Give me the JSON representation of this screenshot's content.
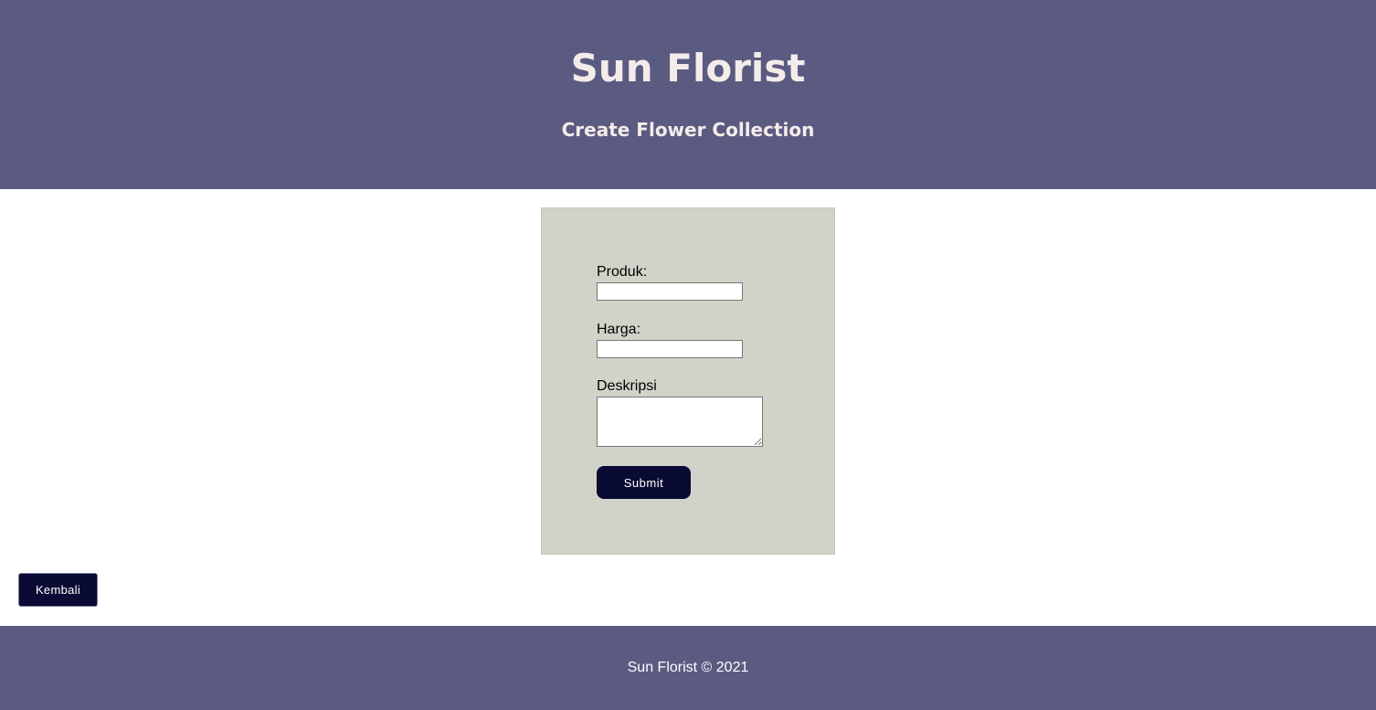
{
  "header": {
    "title": "Sun Florist",
    "subtitle": "Create Flower Collection"
  },
  "form": {
    "produk_label": "Produk:",
    "produk_value": "",
    "harga_label": "Harga:",
    "harga_value": "",
    "deskripsi_label": "Deskripsi",
    "deskripsi_value": "",
    "submit_label": "Submit"
  },
  "navigation": {
    "back_label": "Kembali"
  },
  "footer": {
    "text": "Sun Florist © 2021"
  },
  "colors": {
    "header_bg": "#5b5b82",
    "title_text": "#f4ecea",
    "form_bg": "#d1d3c9",
    "button_bg": "#0a0b34"
  }
}
